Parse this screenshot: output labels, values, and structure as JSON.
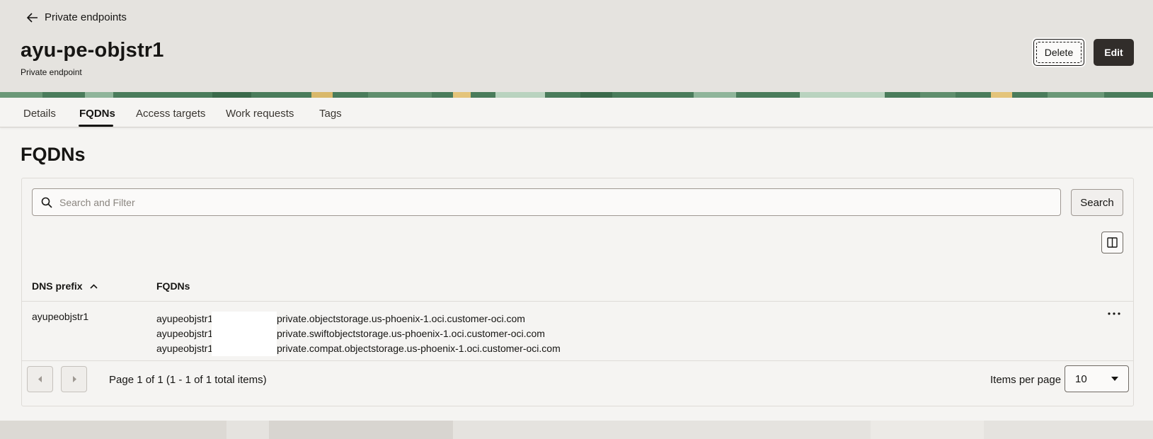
{
  "header": {
    "back_label": "Private endpoints",
    "title": "ayu-pe-objstr1",
    "subtitle": "Private endpoint",
    "delete_label": "Delete",
    "edit_label": "Edit"
  },
  "tabs": [
    {
      "label": "Details"
    },
    {
      "label": "FQDNs"
    },
    {
      "label": "Access targets"
    },
    {
      "label": "Work requests"
    },
    {
      "label": "Tags"
    }
  ],
  "active_tab": "FQDNs",
  "section": {
    "title": "FQDNs"
  },
  "search": {
    "placeholder": "Search and Filter",
    "button_label": "Search"
  },
  "table": {
    "columns": [
      "DNS prefix",
      "FQDNs"
    ],
    "sort": {
      "column": "DNS prefix",
      "direction": "ascending"
    },
    "rows": [
      {
        "dns_prefix": "ayupeobjstr1",
        "fqdns": [
          {
            "prefix": "ayupeobjstr1",
            "suffix": "private.objectstorage.us-phoenix-1.oci.customer-oci.com"
          },
          {
            "prefix": "ayupeobjstr1",
            "suffix": "private.swiftobjectstorage.us-phoenix-1.oci.customer-oci.com"
          },
          {
            "prefix": "ayupeobjstr1",
            "suffix": "private.compat.objectstorage.us-phoenix-1.oci.customer-oci.com"
          }
        ]
      }
    ]
  },
  "pagination": {
    "status": "Page 1 of 1 (1 - 1 of 1 total items)",
    "items_per_page_label": "Items per page",
    "items_per_page_value": "10"
  },
  "colors": {
    "primary_button": "#312d2a",
    "header_bg": "#e5e3df",
    "banner_green": "#4a7c5b"
  }
}
